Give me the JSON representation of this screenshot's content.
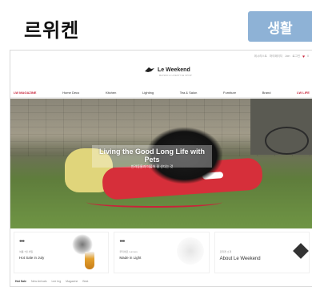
{
  "header": {
    "brand": "르위켄",
    "category": "생활"
  },
  "site": {
    "util_links": [
      "위시리스트",
      "마이페이지",
      "Join",
      "로그인",
      "0"
    ],
    "logo_text": "Le Weekend",
    "logo_sub": "MAISON & LIFESTYLE SHOP",
    "nav": [
      "LW MAGAZINE",
      "Home Deco",
      "Kitchen",
      "Lighting",
      "Tea & Salon",
      "Furniture",
      "Brand",
      "LW LIFE"
    ]
  },
  "hero": {
    "title": "Living the Good Long Life with Pets",
    "subtitle": "반려동물과 더불어 잘 산다는 것"
  },
  "cards": [
    {
      "dots": "●●●",
      "small": "여름 7월 세일",
      "title": "Hot Sale in July"
    },
    {
      "dots": "●●●",
      "small": "루미에르 Lumiere",
      "title": "Made in Light"
    },
    {
      "dots": "",
      "small": "르위켄 소개",
      "title": "About Le Weekend"
    }
  ],
  "tabs": [
    "Hot Sale",
    "New Arrivals",
    "Lee Ing",
    "Magazine",
    "Best"
  ]
}
